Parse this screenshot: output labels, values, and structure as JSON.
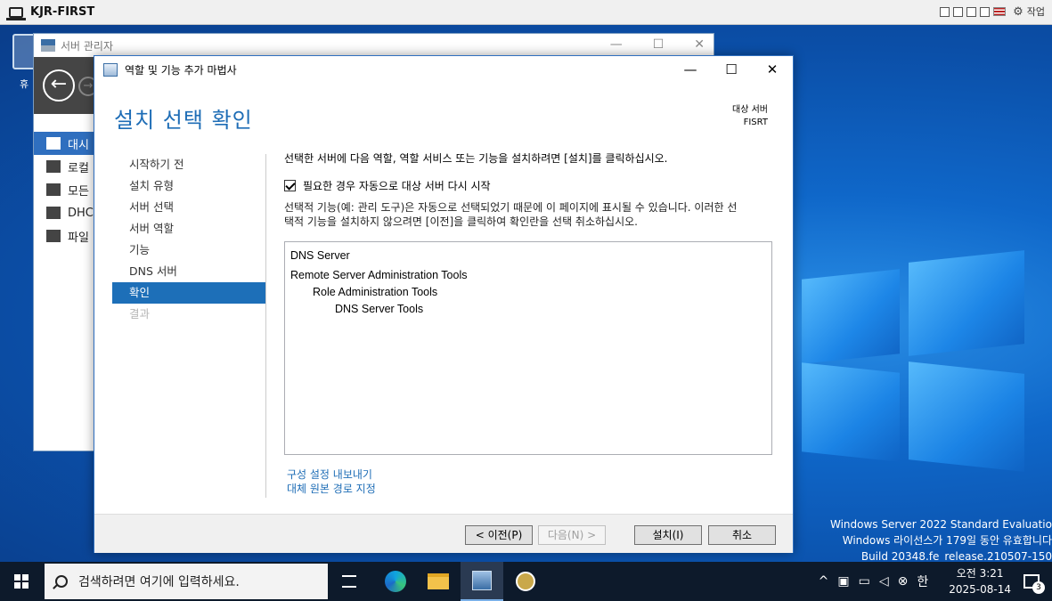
{
  "vm": {
    "title": "KJR-FIRST",
    "toolbar_label": "작업"
  },
  "desktop": {
    "recycle_label": "휴",
    "watermark": {
      "line1": "Windows Server 2022 Standard Evaluatio",
      "line2": "Windows 라이선스가 179일 동안 유효합니다",
      "line3": "Build 20348.fe_release.210507-150"
    }
  },
  "server_manager": {
    "title": "서버 관리자",
    "side_items": [
      {
        "label": "대시",
        "selected": true
      },
      {
        "label": "로컬"
      },
      {
        "label": "모든"
      },
      {
        "label": "DHC"
      },
      {
        "label": "파일"
      }
    ]
  },
  "wizard": {
    "title": "역할 및 기능 추가 마법사",
    "heading": "설치 선택 확인",
    "target_label": "대상 서버",
    "target_name": "FISRT",
    "nav": [
      {
        "label": "시작하기 전",
        "state": "normal"
      },
      {
        "label": "설치 유형",
        "state": "normal"
      },
      {
        "label": "서버 선택",
        "state": "normal"
      },
      {
        "label": "서버 역할",
        "state": "normal"
      },
      {
        "label": "기능",
        "state": "normal"
      },
      {
        "label": "DNS 서버",
        "state": "normal"
      },
      {
        "label": "확인",
        "state": "selected"
      },
      {
        "label": "결과",
        "state": "disabled"
      }
    ],
    "intro": "선택한 서버에 다음 역할, 역할 서비스 또는 기능을 설치하려면 [설치]를 클릭하십시오.",
    "restart_checkbox": {
      "label": "필요한 경우 자동으로 대상 서버 다시 시작",
      "checked": true
    },
    "description_line1": "선택적 기능(예: 관리 도구)은 자동으로 선택되었기 때문에 이 페이지에 표시될 수 있습니다. 이러한 선",
    "description_line2": "택적 기능을 설치하지 않으려면 [이전]을 클릭하여 확인란을 선택 취소하십시오.",
    "items": [
      {
        "label": "DNS Server",
        "level": 0
      },
      {
        "label": "Remote Server Administration Tools",
        "level": 0
      },
      {
        "label": "Role Administration Tools",
        "level": 1
      },
      {
        "label": "DNS Server Tools",
        "level": 2
      }
    ],
    "links": {
      "export": "구성 설정 내보내기",
      "alternate_source": "대체 원본 경로 지정"
    },
    "buttons": {
      "previous": "< 이전(P)",
      "next": "다음(N) >",
      "install": "설치(I)",
      "cancel": "취소"
    }
  },
  "taskbar": {
    "search_placeholder": "검색하려면 여기에 입력하세요.",
    "ime": "한",
    "time": "오전 3:21",
    "date": "2025-08-14",
    "notification_count": "3"
  }
}
